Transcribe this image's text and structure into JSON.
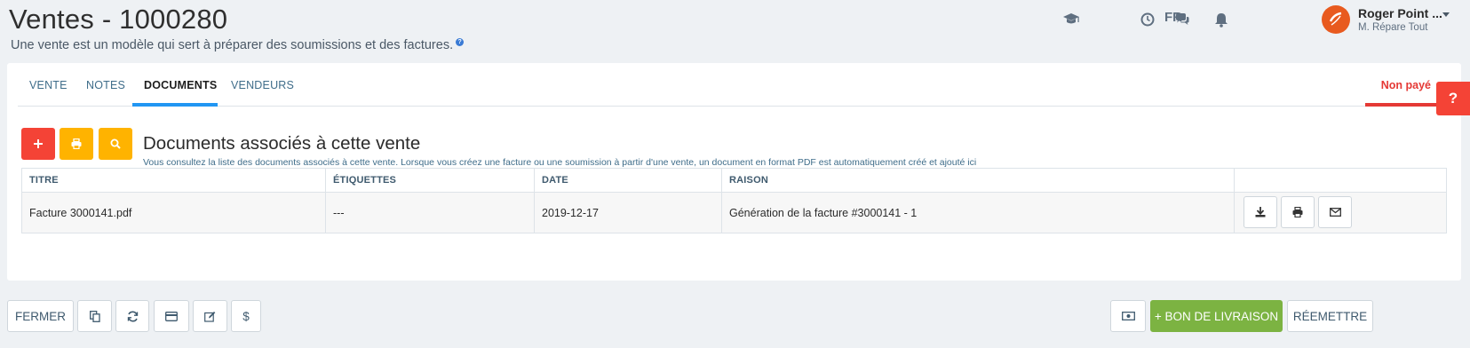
{
  "header": {
    "title": "Ventes - 1000280",
    "subtitle": "Une vente est un modèle qui sert à préparer des soumissions et des factures.",
    "language": "FR",
    "user": {
      "name": "Roger Point ...",
      "role": "M. Répare Tout"
    },
    "icons": [
      "graduation-cap-icon",
      "clock-icon",
      "chat-icon",
      "bell-icon"
    ]
  },
  "tabs": [
    "VENTE",
    "NOTES",
    "DOCUMENTS",
    "VENDEURS"
  ],
  "active_tab": "DOCUMENTS",
  "status": "Non payé",
  "documents": {
    "title": "Documents associés à cette vente",
    "description": "Vous consultez la liste des documents associés à cette vente. Lorsque vous créez une facture ou une soumission à partir d'une vente, un document en format PDF est automatiquement créé et ajouté ici",
    "columns": [
      "TITRE",
      "ÉTIQUETTES",
      "DATE",
      "RAISON"
    ],
    "rows": [
      {
        "titre": "Facture 3000141.pdf",
        "etiquettes": "---",
        "date": "2019-12-17",
        "raison": "Génération de la facture #3000141 - 1"
      }
    ]
  },
  "footer": {
    "close": "FERMER",
    "delivery": "+ BON DE LIVRAISON",
    "reissue": "RÉEMETTRE",
    "dollar": "$"
  },
  "colors": {
    "red": "#f44336",
    "yellow": "#ffb300",
    "green": "#7cb342",
    "blue": "#2196f3"
  }
}
